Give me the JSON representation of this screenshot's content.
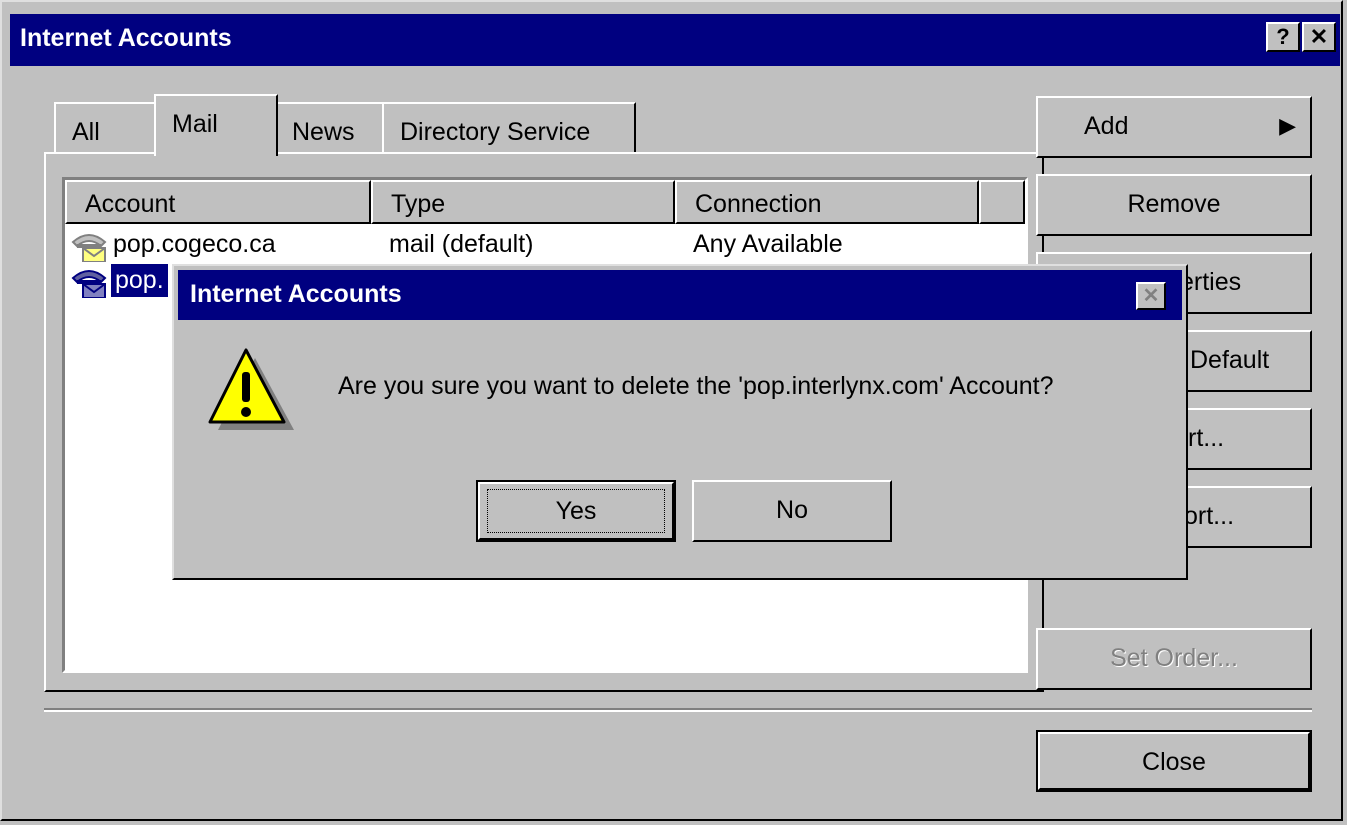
{
  "window": {
    "title": "Internet Accounts",
    "help_label": "?",
    "close_label": "✕"
  },
  "tabs": [
    {
      "label": "All"
    },
    {
      "label": "Mail"
    },
    {
      "label": "News"
    },
    {
      "label": "Directory Service"
    }
  ],
  "list": {
    "columns": [
      "Account",
      "Type",
      "Connection"
    ],
    "rows": [
      {
        "account": "pop.cogeco.ca",
        "type": "mail (default)",
        "connection": "Any Available"
      },
      {
        "account": "pop.",
        "type": "",
        "connection": ""
      }
    ]
  },
  "side_buttons": {
    "add": "Add",
    "remove": "Remove",
    "properties": "erties",
    "set_default": "Default",
    "import": "rt...",
    "export": "ort...",
    "set_order": "Set Order...",
    "close": "Close"
  },
  "dialog": {
    "title": "Internet Accounts",
    "message": "Are you sure you want to delete the 'pop.interlynx.com' Account?",
    "yes": "Yes",
    "no": "No",
    "close_label": "✕"
  },
  "colors": {
    "title_bar": "#000080",
    "face": "#c0c0c0"
  }
}
